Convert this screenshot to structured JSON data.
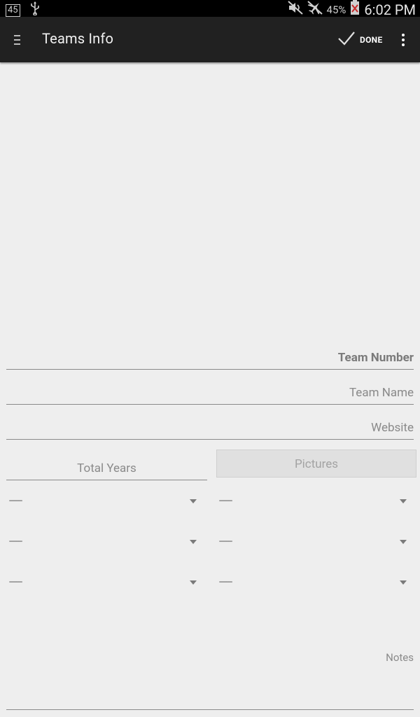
{
  "status_bar": {
    "notification_badge": "45",
    "icons": [
      "usb-icon",
      "mute-icon",
      "airplane-icon",
      "battery-icon"
    ],
    "battery_percent": "45%",
    "time": "6:02 PM"
  },
  "action_bar": {
    "title": "Teams Info",
    "done_label": "DONE",
    "icons": [
      "menu-icon",
      "check-icon",
      "overflow-icon"
    ]
  },
  "form": {
    "team_number_hint": "Team Number",
    "team_name_hint": "Team Name",
    "website_hint": "Website",
    "total_years_hint": "Total Years",
    "pictures_label": "Pictures",
    "spinners": {
      "left": [
        "-------",
        "-------",
        "-------"
      ],
      "right": [
        "-------",
        "-------",
        "-------"
      ]
    },
    "notes_hint": "Notes"
  }
}
